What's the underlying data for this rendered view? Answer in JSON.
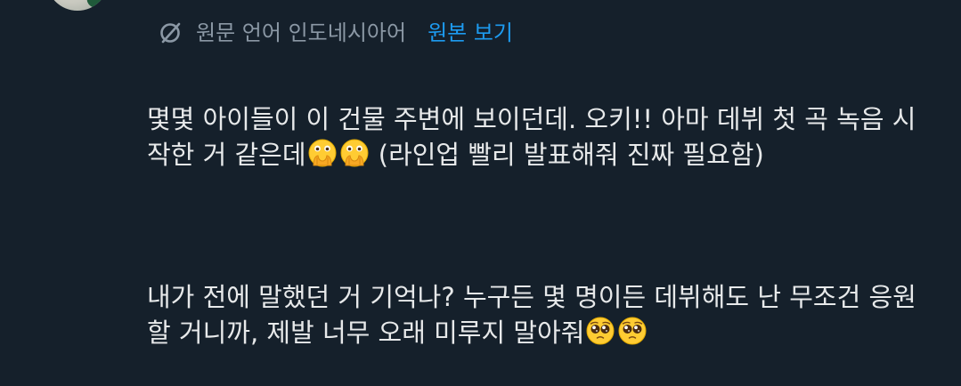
{
  "translation_bar": {
    "icon": "translate-icon",
    "language_label": "원문 언어 인도네시아어",
    "show_original_label": "원본 보기"
  },
  "tweet": {
    "paragraph1": {
      "text": "몇몇 아이들이 이 건물 주변에 보이던데. 오키!! 아마 데뷔 첫 곡 녹음 시작한 거 같은데",
      "tail": " (라인업 빨리 발표해줘 진짜 필요함)",
      "emojis": [
        "face-with-open-eyes-and-hand-over-mouth",
        "face-with-open-eyes-and-hand-over-mouth"
      ]
    },
    "paragraph2": {
      "text": "내가 전에 말했던 거 기억나? 누구든 몇 명이든 데뷔해도 난 무조건 응원할 거니까, 제발 너무 오래 미루지 말아줘",
      "emojis": [
        "pleading-face",
        "pleading-face"
      ]
    }
  },
  "colors": {
    "background": "#15202b",
    "text": "#e7e9ea",
    "muted": "#8b98a5",
    "link": "#1d9bf0"
  }
}
